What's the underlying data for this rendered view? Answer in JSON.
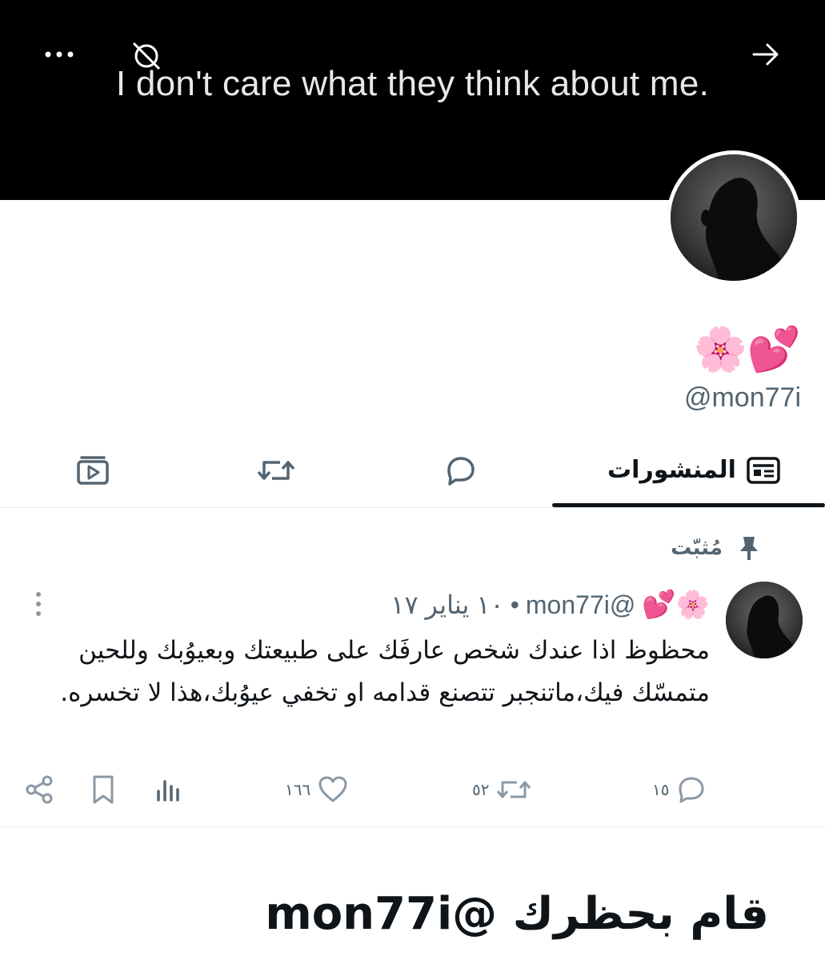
{
  "banner": {
    "text": "I don't care what they think about me."
  },
  "profile": {
    "display_name": "🌸💕",
    "handle": "@mon77i"
  },
  "tabs": {
    "posts_label": "المنشورات"
  },
  "pinned": {
    "label": "مُثبّت"
  },
  "post": {
    "name": "🌸💕",
    "handle": "@mon77i",
    "dot": "•",
    "date": "١٠ يناير ١٧",
    "text": "محظوظ اذا عندك شخص عارفَك على طبيعتك وبعيوُبك وللحين متمسّك فيك،ماتنجبر تتصنع قدامه او تخفي عيوُبك،هذا لا تخسره.",
    "replies": "١٥",
    "reposts": "٥٢",
    "likes": "١٦٦"
  },
  "caption": {
    "text": "قام بحظرك @mon77i"
  },
  "icons": {
    "more": "more-horizontal-icon",
    "arrow": "arrow-right-icon",
    "hidden": "hidden-eye-icon",
    "pin": "pin-icon",
    "reply": "reply-icon",
    "repost": "repost-icon",
    "like": "heart-icon",
    "views": "views-icon",
    "bookmark": "bookmark-icon",
    "share": "share-icon"
  },
  "colors": {
    "banner_bg": "#000000",
    "text_primary": "#0f1419",
    "text_secondary": "#536471",
    "divider": "#e6e9ec"
  }
}
